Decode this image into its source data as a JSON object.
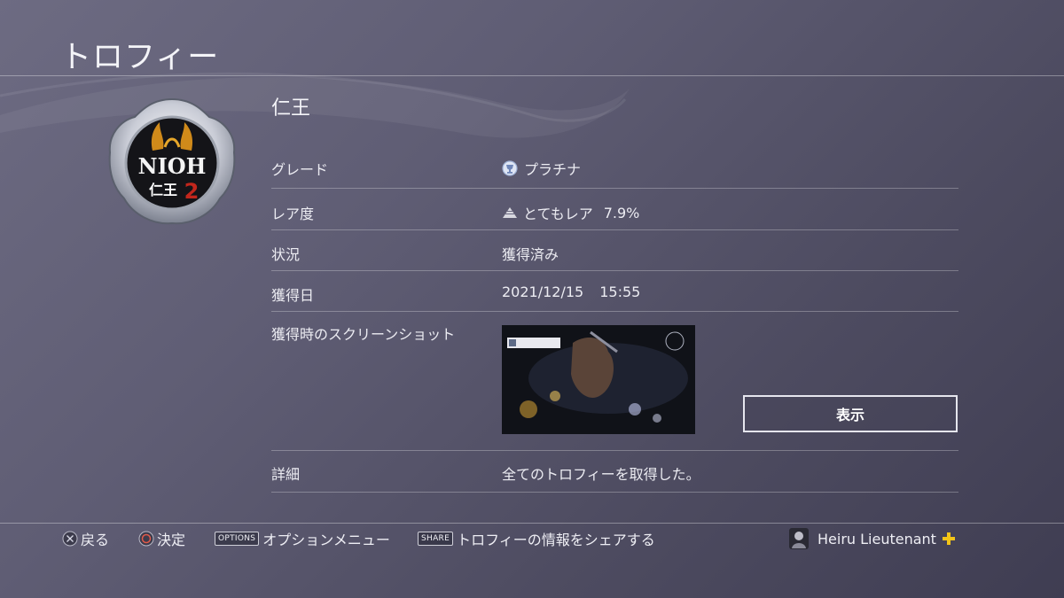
{
  "header": {
    "title": "トロフィー"
  },
  "game": {
    "title": "仁王",
    "icon_name": "nioh2-trophy-icon",
    "icon_text_top": "NIOH",
    "icon_text_jp": "仁王",
    "icon_text_num": "2"
  },
  "details": {
    "grade": {
      "label": "グレード",
      "icon": "platinum-trophy-icon",
      "value": "プラチナ"
    },
    "rarity": {
      "label": "レア度",
      "icon": "rarity-pyramid-icon",
      "value": "とてもレア",
      "percent": "7.9%"
    },
    "status": {
      "label": "状況",
      "value": "獲得済み"
    },
    "earned": {
      "label": "獲得日",
      "date": "2021/12/15",
      "time": "15:55"
    },
    "screenshot": {
      "label": "獲得時のスクリーンショット",
      "button_label": "表示"
    },
    "detail": {
      "label": "詳細",
      "value": "全てのトロフィーを取得した。"
    }
  },
  "footer": {
    "back_label": "戻る",
    "confirm_label": "決定",
    "options_key": "OPTIONS",
    "options_label": "オプションメニュー",
    "share_key": "SHARE",
    "share_label": "トロフィーの情報をシェアする",
    "username": "Heiru Lieutenant"
  },
  "colors": {
    "accent_plus": "#f2c418",
    "background": "#5f5d74"
  }
}
